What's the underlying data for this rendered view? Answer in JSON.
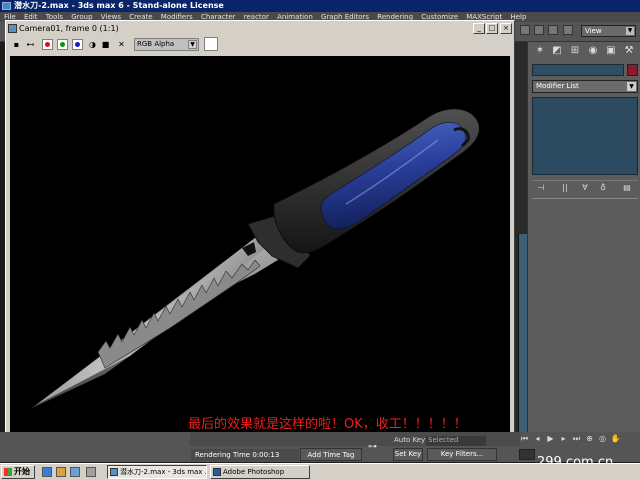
{
  "app": {
    "title": "潜水刀-2.max - 3ds max 6 - Stand-alone License"
  },
  "menu": [
    "File",
    "Edit",
    "Tools",
    "Group",
    "Views",
    "Create",
    "Modifiers",
    "Character",
    "reactor",
    "Animation",
    "Graph Editors",
    "Rendering",
    "Customize",
    "MAXScript",
    "Help"
  ],
  "toolbar": {
    "view_dropdown": "View"
  },
  "command_panel": {
    "modifier_list": "Modifier List",
    "object_color": "#8a1a2c"
  },
  "render_window": {
    "title": "Camera01, frame 0 (1:1)",
    "channel": "RGB Alpha",
    "caption": "最后的效果就是这样的啦！OK，收工！！！！！",
    "caption_color": "#e8201e"
  },
  "status": {
    "rendering_time": "Rendering Time  0:00:13",
    "add_time_tag": "Add Time Tag",
    "auto_key": "Auto Key",
    "selected": "Selected",
    "set_key": "Set Key",
    "key_filters": "Key Filters..."
  },
  "taskbar": {
    "start": "开始",
    "tasks": [
      "潜水刀-2.max - 3ds max ...",
      "Adobe Photoshop"
    ]
  },
  "watermark": "299.com.cn"
}
